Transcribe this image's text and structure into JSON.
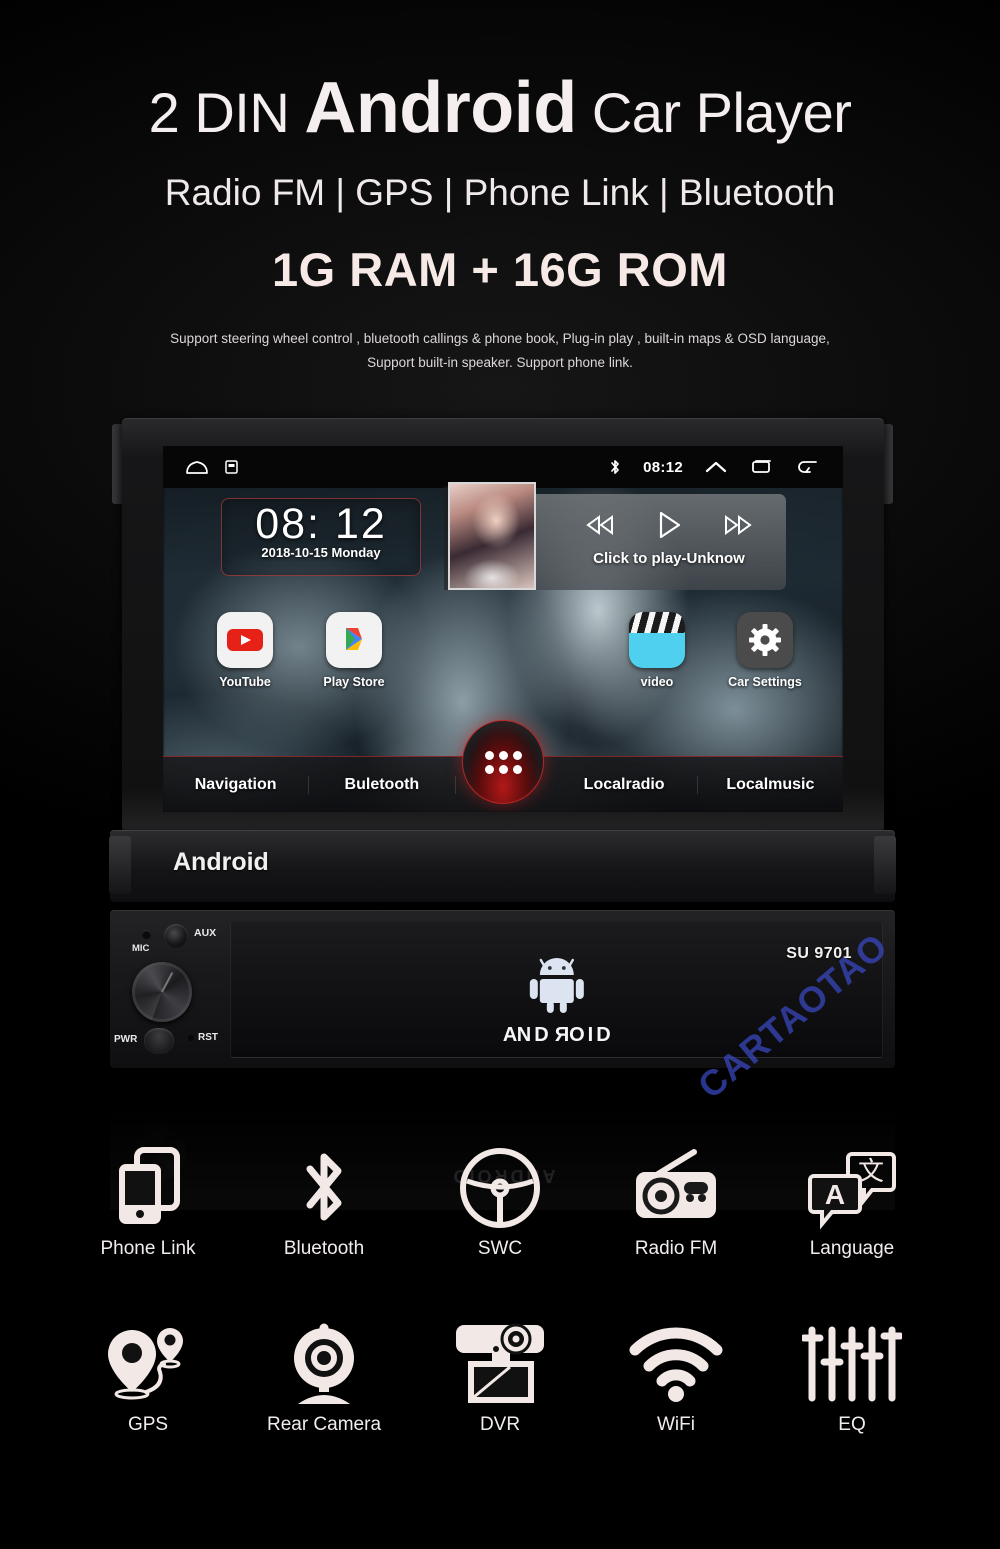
{
  "header": {
    "title_pre": "2 DIN ",
    "title_main": "Android",
    "title_post": " Car Player",
    "subtitle": "Radio FM | GPS | Phone Link | Bluetooth",
    "ram_rom": "1G RAM + 16G ROM",
    "description_line1": "Support steering wheel control , bluetooth callings & phone book,  Plug-in play , built-in maps & OSD language,",
    "description_line2": "Support built-in speaker. Support phone link."
  },
  "device": {
    "screen": {
      "statusbar": {
        "home_icon": "home-icon",
        "sd_icon": "sd-card-icon",
        "bluetooth_icon": "bluetooth-icon",
        "time": "08:12",
        "expand_icon": "chevron-up-icon",
        "recents_icon": "recent-apps-icon",
        "back_icon": "back-arrow-icon"
      },
      "clock_widget": {
        "time": "08: 12",
        "date": "2018-10-15 Monday"
      },
      "media_widget": {
        "prev_icon": "rewind-icon",
        "play_icon": "play-icon",
        "next_icon": "fast-forward-icon",
        "label": "Click to play-Unknow"
      },
      "apps": [
        {
          "label": "YouTube",
          "icon": "youtube-icon"
        },
        {
          "label": "Play Store",
          "icon": "play-store-icon"
        },
        {
          "label": "video",
          "icon": "video-clapper-icon"
        },
        {
          "label": "Car Settings",
          "icon": "gear-icon"
        }
      ],
      "dock": {
        "left": [
          "Navigation",
          "Buletooth"
        ],
        "right": [
          "Localradio",
          "Localmusic"
        ],
        "drawer_icon": "app-drawer-icon"
      }
    },
    "faceplate": {
      "brand": "Android",
      "model": "SU 9701",
      "logo_word": "ANDROID",
      "controls": {
        "mic": "MIC",
        "aux": "AUX",
        "power": "PWR",
        "reset": "RST"
      }
    },
    "watermark": "CARTAOTAO"
  },
  "features": [
    [
      {
        "label": "Phone Link",
        "icon": "phone-link-icon"
      },
      {
        "label": "Bluetooth",
        "icon": "bluetooth-icon"
      },
      {
        "label": "SWC",
        "icon": "steering-wheel-icon"
      },
      {
        "label": "Radio  FM",
        "icon": "radio-icon"
      },
      {
        "label": "Language",
        "icon": "translate-icon"
      }
    ],
    [
      {
        "label": "GPS",
        "icon": "map-pin-icon"
      },
      {
        "label": "Rear Camera",
        "icon": "webcam-icon"
      },
      {
        "label": "DVR",
        "icon": "dashcam-icon"
      },
      {
        "label": "WiFi",
        "icon": "wifi-icon"
      },
      {
        "label": "EQ",
        "icon": "equalizer-icon"
      }
    ]
  ],
  "colors": {
    "accent_red": "#b31818",
    "text": "#f2eded",
    "watermark": "#3a49c4"
  }
}
